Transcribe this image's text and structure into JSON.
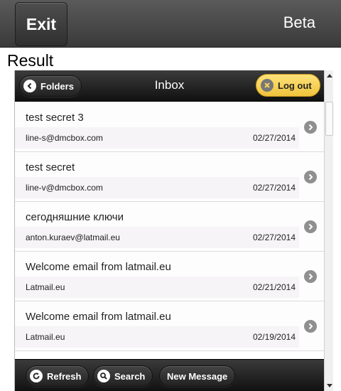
{
  "appbar": {
    "exit_label": "Exit",
    "beta_label": "Beta"
  },
  "result_label": "Result",
  "mail": {
    "header": {
      "folders_label": "Folders",
      "title": "Inbox",
      "logout_label": "Log out"
    },
    "messages": [
      {
        "subject": "test secret 3",
        "sender": "line-s@dmcbox.com",
        "date": "02/27/2014"
      },
      {
        "subject": "test secret",
        "sender": "line-v@dmcbox.com",
        "date": "02/27/2014"
      },
      {
        "subject": "сегодняшние ключи",
        "sender": "anton.kuraev@latmail.eu",
        "date": "02/27/2014"
      },
      {
        "subject": "Welcome email from latmail.eu",
        "sender": "Latmail.eu",
        "date": "02/21/2014"
      },
      {
        "subject": "Welcome email from latmail.eu",
        "sender": "Latmail.eu",
        "date": "02/19/2014"
      }
    ],
    "footer": {
      "refresh_label": "Refresh",
      "search_label": "Search",
      "new_message_label": "New Message"
    }
  },
  "colors": {
    "logout_accent": "#f5cf4e",
    "bar_dark": "#1a1a1a"
  }
}
